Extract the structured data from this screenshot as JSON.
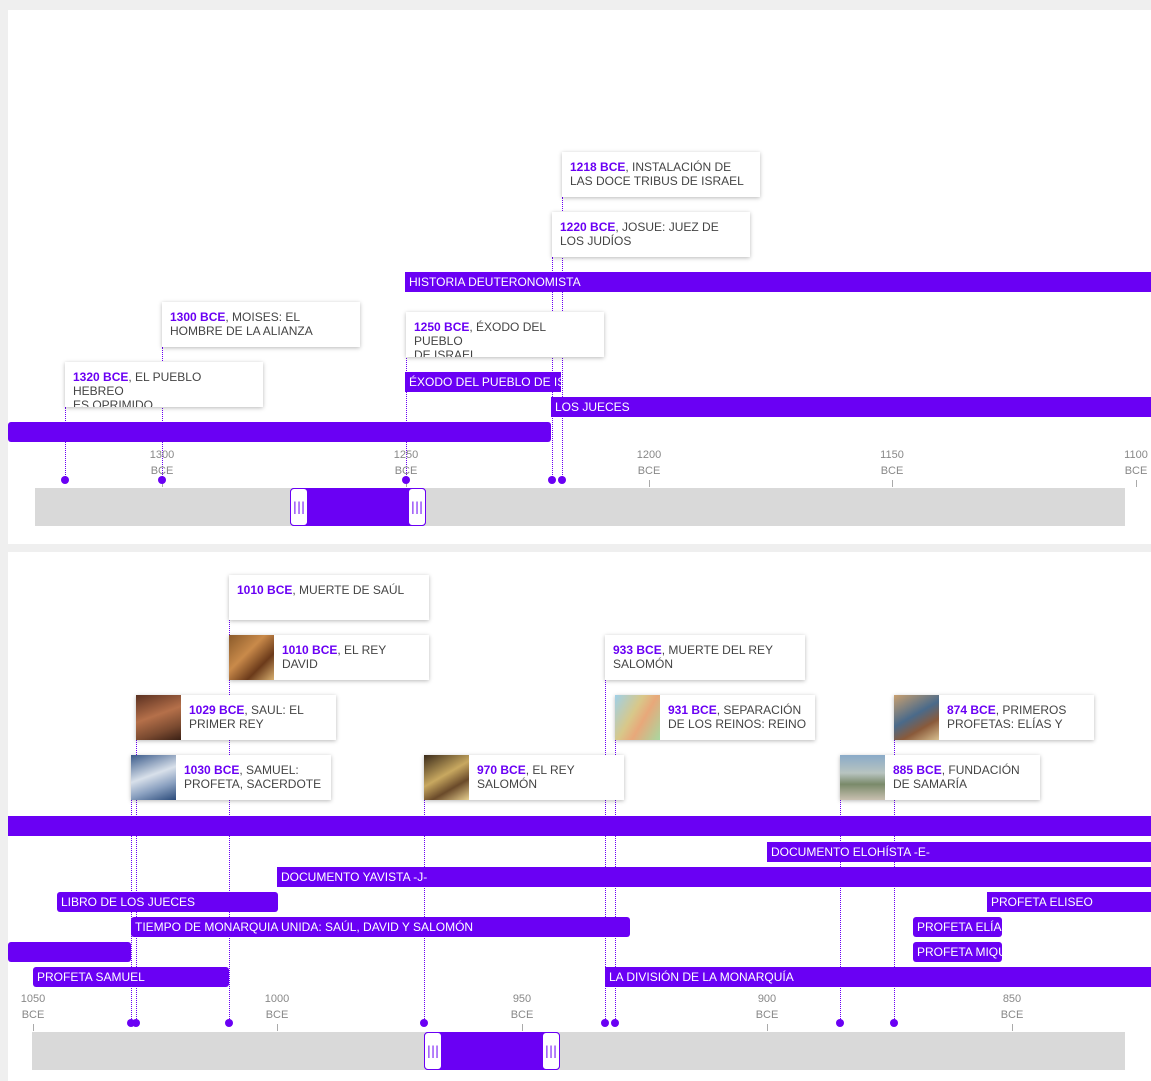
{
  "theme": {
    "accent": "#6a00f4",
    "navigator_track": "#d9d9d9",
    "background": "#ffffff"
  },
  "timeline1": {
    "events": [
      {
        "date": "1218 BCE",
        "text": "INSTALACIÓN DE",
        "text2": "LAS DOCE TRIBUS DE ISRAEL"
      },
      {
        "date": "1220 BCE",
        "text": "JOSUE: JUEZ DE",
        "text2": "LOS JUDÍOS"
      },
      {
        "date": "1300 BCE",
        "text": "MOISES: EL",
        "text2": "HOMBRE DE LA ALIANZA"
      },
      {
        "date": "1250 BCE",
        "text": "ÉXODO DEL PUEBLO",
        "text2": "DE ISRAEL"
      },
      {
        "date": "1320 BCE",
        "text": "EL PUEBLO HEBREO",
        "text2": "ES OPRIMIDO"
      }
    ],
    "eras": {
      "historia_deuteronomista": "HISTORIA DEUTERONOMISTA",
      "exodo": "ÉXODO DEL PUEBLO DE ISRAEL",
      "los_jueces": "LOS JUECES"
    },
    "ticks": [
      {
        "year": "1300",
        "era": "BCE"
      },
      {
        "year": "1250",
        "era": "BCE"
      },
      {
        "year": "1200",
        "era": "BCE"
      },
      {
        "year": "1150",
        "era": "BCE"
      },
      {
        "year": "1100",
        "era": "BCE"
      }
    ],
    "handle_glyph": "|||"
  },
  "timeline2": {
    "events": [
      {
        "date": "1010 BCE",
        "text": "MUERTE DE SAÚL",
        "text2": ""
      },
      {
        "date": "1010 BCE",
        "text": "EL REY",
        "text2": "DAVID"
      },
      {
        "date": "933 BCE",
        "text": "MUERTE DEL REY",
        "text2": "SALOMÓN"
      },
      {
        "date": "1029 BCE",
        "text": "SAUL: EL",
        "text2": "PRIMER REY"
      },
      {
        "date": "931 BCE",
        "text": "SEPARACIÓN",
        "text2": "DE LOS REINOS: REINO"
      },
      {
        "date": "874 BCE",
        "text": "PRIMEROS",
        "text2": "PROFETAS: ELÍAS Y"
      },
      {
        "date": "1030 BCE",
        "text": "SAMUEL:",
        "text2": "PROFETA, SACERDOTE"
      },
      {
        "date": "970 BCE",
        "text": "EL REY",
        "text2": "SALOMÓN"
      },
      {
        "date": "885 BCE",
        "text": "FUNDACIÓN",
        "text2": "DE SAMARÍA"
      }
    ],
    "eras": {
      "documento_elohista": "DOCUMENTO ELOHÍSTA -E-",
      "documento_yavista": "DOCUMENTO YAVISTA -J-",
      "libro_jueces": "LIBRO DE LOS JUECES",
      "profeta_eliseo": "PROFETA ELISEO",
      "monarquia_unida": "TIEMPO DE MONARQUIA UNIDA: SAÚL, DAVID Y SALOMÓN",
      "profeta_elias": "PROFETA ELÍAS",
      "profeta_miqueas": "PROFETA MIQUEAS",
      "profeta_samuel": "PROFETA SAMUEL",
      "division_monarquia": "LA DIVISIÓN DE LA MONARQUÍA"
    },
    "ticks": [
      {
        "year": "1050",
        "era": "BCE"
      },
      {
        "year": "1000",
        "era": "BCE"
      },
      {
        "year": "950",
        "era": "BCE"
      },
      {
        "year": "900",
        "era": "BCE"
      },
      {
        "year": "850",
        "era": "BCE"
      }
    ],
    "handle_glyph": "|||"
  }
}
